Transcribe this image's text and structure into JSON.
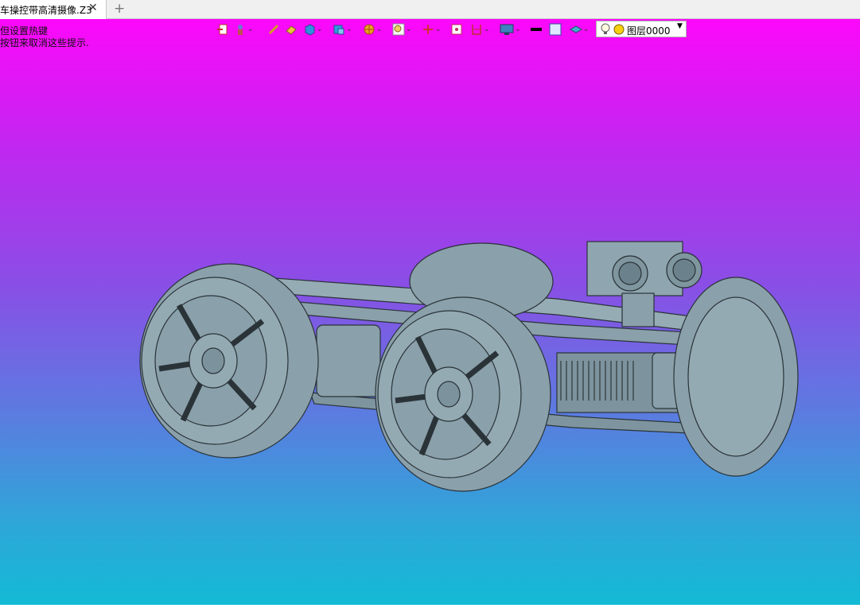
{
  "tab": {
    "title": "车操控带高清摄像.Z3",
    "close_icon": "close-icon",
    "add_icon": "plus-icon"
  },
  "hints": {
    "line1": "但设置热键",
    "line2": "按钮来取消这些提示."
  },
  "toolbar": {
    "icons": [
      "import-icon",
      "sketch-tool-icon",
      "line-tool-icon",
      "shape-tool-icon",
      "cube-icon",
      "view-cube-icon",
      "render-mode-icon",
      "zoom-icon",
      "axis-icon",
      "grid-icon",
      "section-icon",
      "display-icon",
      "line-color-icon",
      "fill-color-icon",
      "layer-stack-icon"
    ]
  },
  "layer": {
    "bulb_icon": "lightbulb-icon",
    "dot_icon": "layer-color-dot-icon",
    "name": "图层0000"
  },
  "colors": {
    "gradient_top": "#fc08fa",
    "gradient_bottom": "#13bad6",
    "model": "#8aa0aa"
  }
}
